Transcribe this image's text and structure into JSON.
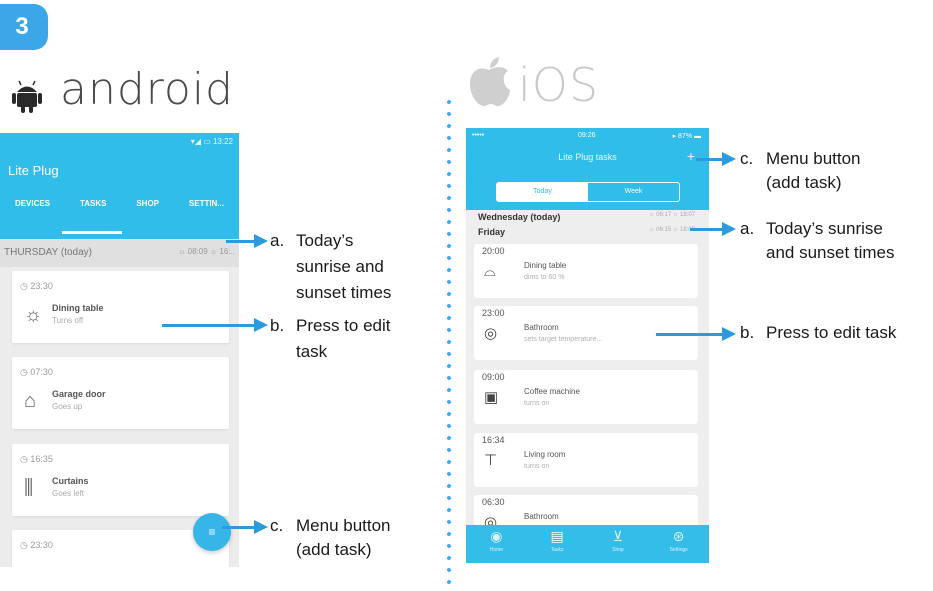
{
  "step_number": "3",
  "android": {
    "platform_label": "android",
    "status": "▾◢ ▭ 13:22",
    "app_title": "Lite Plug",
    "tabs": [
      "DEVICES",
      "TASKS",
      "SHOP",
      "SETTIN..."
    ],
    "active_tab": "TASKS",
    "day_label": "THURSDAY (today)",
    "sun_times": "☼ 08:09  ☼ 16:..",
    "tasks": [
      {
        "time": "◷ 23:30",
        "name": "Dining table",
        "detail": "Turns off",
        "icon": "sun-icon"
      },
      {
        "time": "◷ 07:30",
        "name": "Garage door",
        "detail": "Goes up",
        "icon": "garage-icon"
      },
      {
        "time": "◷ 16:35",
        "name": "Curtains",
        "detail": "Goes left",
        "icon": "curtains-icon"
      },
      {
        "time": "◷ 23:30",
        "name": "",
        "detail": "",
        "icon": ""
      }
    ],
    "fab_label": "≡"
  },
  "ios": {
    "platform_label": "iOS",
    "status_left": "•••••",
    "status_center": "09:26",
    "status_right": "▸ 87% ▬",
    "app_title": "Lite Plug tasks",
    "add_button": "+",
    "segments": [
      "Today",
      "Week"
    ],
    "day1": "Wednesday (today)",
    "day2": "Friday",
    "sun1": "☼ 06:17   ☼ 18:07",
    "sun2": "☼ 06:15   ☼ 18:08",
    "tasks": [
      {
        "time": "20:00",
        "name": "Dining table",
        "detail": "dims to 60 %",
        "icon": "ceiling-lamp-icon"
      },
      {
        "time": "23:00",
        "name": "Bathroom",
        "detail": "sets target temperature...",
        "icon": "heater-icon"
      },
      {
        "time": "09:00",
        "name": "Coffee machine",
        "detail": "turns on",
        "icon": "coffee-machine-icon"
      },
      {
        "time": "16:34",
        "name": "Living room",
        "detail": "turns on",
        "icon": "lamp-icon"
      },
      {
        "time": "06:30",
        "name": "Bathroom",
        "detail": "",
        "icon": "heater-icon"
      }
    ],
    "tabbar": [
      {
        "label": "Home",
        "icon": "home-icon"
      },
      {
        "label": "Tasks",
        "icon": "tasks-icon"
      },
      {
        "label": "Shop",
        "icon": "cart-icon"
      },
      {
        "label": "Settings",
        "icon": "settings-icon"
      }
    ]
  },
  "annotations_android": {
    "a": {
      "letter": "a.",
      "text": [
        "Today’s",
        "sunrise and",
        "sunset times"
      ]
    },
    "b": {
      "letter": "b.",
      "text": [
        "Press to edit",
        "task"
      ]
    },
    "c": {
      "letter": "c.",
      "text": [
        "Menu button",
        "(add task)"
      ]
    }
  },
  "annotations_ios": {
    "c": {
      "letter": "c.",
      "text": [
        "Menu button",
        "(add task)"
      ]
    },
    "a": {
      "letter": "a.",
      "text": [
        "Today’s sunrise",
        "and sunset times"
      ]
    },
    "b": {
      "letter": "b.",
      "text": [
        "Press to edit task"
      ]
    }
  },
  "colors": {
    "accent": "#30bde9",
    "arrow": "#2d9ae0",
    "badge": "#3ba7e8"
  }
}
